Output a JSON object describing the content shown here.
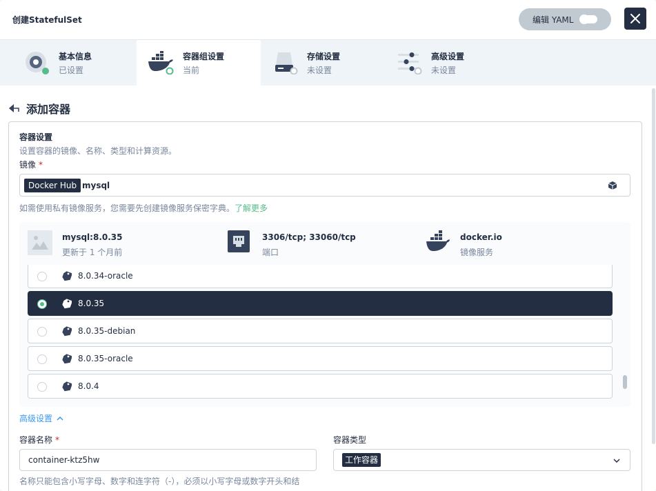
{
  "header": {
    "title": "创建StatefulSet",
    "yaml_label": "编辑 YAML"
  },
  "tabs": [
    {
      "name": "基本信息",
      "status": "已设置",
      "icon": "basic-info-icon"
    },
    {
      "name": "容器组设置",
      "status": "当前",
      "icon": "docker-icon"
    },
    {
      "name": "存储设置",
      "status": "未设置",
      "icon": "storage-icon"
    },
    {
      "name": "高级设置",
      "status": "未设置",
      "icon": "advanced-settings-icon"
    }
  ],
  "page": {
    "back_title": "添加容器"
  },
  "container_settings": {
    "title": "容器设置",
    "description": "设置容器的镜像、名称、类型和计算资源。",
    "image_label": "镜像",
    "image_required": "*",
    "registry_tag": "Docker Hub",
    "image_value": "mysql",
    "hint_text": "如需使用私有镜像服务，您需要先创建镜像服务保密字典。",
    "hint_link": "了解更多"
  },
  "image_info": {
    "name": "mysql:8.0.35",
    "updated": "更新于 1 个月前",
    "ports": "3306/tcp; 33060/tcp",
    "ports_label": "端口",
    "registry": "docker.io",
    "registry_label": "镜像服务"
  },
  "versions": [
    {
      "label": "8.0.34-oracle",
      "selected": false
    },
    {
      "label": "8.0.35",
      "selected": true
    },
    {
      "label": "8.0.35-debian",
      "selected": false
    },
    {
      "label": "8.0.35-oracle",
      "selected": false
    },
    {
      "label": "8.0.4",
      "selected": false
    }
  ],
  "advanced": {
    "toggle_label": "高级设置"
  },
  "container": {
    "name_label": "容器名称",
    "name_required": "*",
    "name_value": "container-ktz5hw",
    "type_label": "容器类型",
    "type_value": "工作容器",
    "name_hint": "名称只能包含小写字母、数字和连字符（-），必须以小写字母或数字开头和结"
  },
  "colors": {
    "dark": "#242e42",
    "green": "#55bc8a",
    "link_blue": "#3a98f3",
    "muted": "#79879c"
  }
}
